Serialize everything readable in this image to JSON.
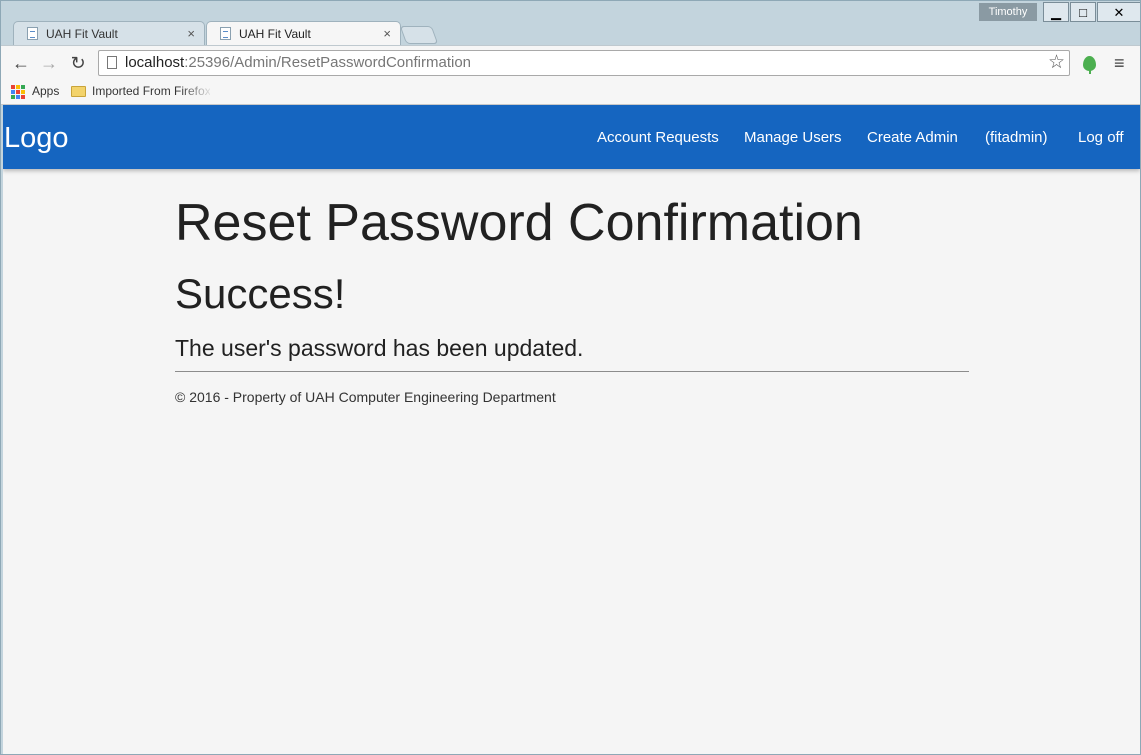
{
  "window": {
    "user_name": "Timothy",
    "minimize_glyph": "▁",
    "maximize_glyph": "□",
    "close_glyph": "✕"
  },
  "tabs": [
    {
      "title": "UAH Fit Vault",
      "active": false,
      "close_glyph": "×"
    },
    {
      "title": "UAH Fit Vault",
      "active": true,
      "close_glyph": "×"
    }
  ],
  "toolbar": {
    "back_glyph": "←",
    "forward_glyph": "→",
    "reload_glyph": "↻",
    "url_host": "localhost",
    "url_path": ":25396/Admin/ResetPasswordConfirmation",
    "star_glyph": "☆",
    "menu_glyph": "≡",
    "icons": [
      "back-arrow-icon",
      "forward-arrow-icon",
      "reload-icon",
      "page-icon",
      "star-icon",
      "extension-icon",
      "menu-icon"
    ]
  },
  "bookmarks": {
    "apps_label": "Apps",
    "folder_label": "Imported From Firefox",
    "apps_colors": [
      "#e94235",
      "#fbbc04",
      "#34a853",
      "#4285f4",
      "#e94235",
      "#fbbc04",
      "#34a853",
      "#4285f4",
      "#e94235"
    ]
  },
  "site": {
    "brand": "Logo",
    "nav": [
      "Account Requests",
      "Manage Users",
      "Create Admin",
      "(fitadmin)",
      "Log off"
    ],
    "navbar_color": "#1565c0"
  },
  "content": {
    "title": "Reset Password Confirmation",
    "status": "Success!",
    "message": "The user's password has been updated.",
    "footer": "© 2016 - Property of UAH Computer Engineering Department"
  }
}
